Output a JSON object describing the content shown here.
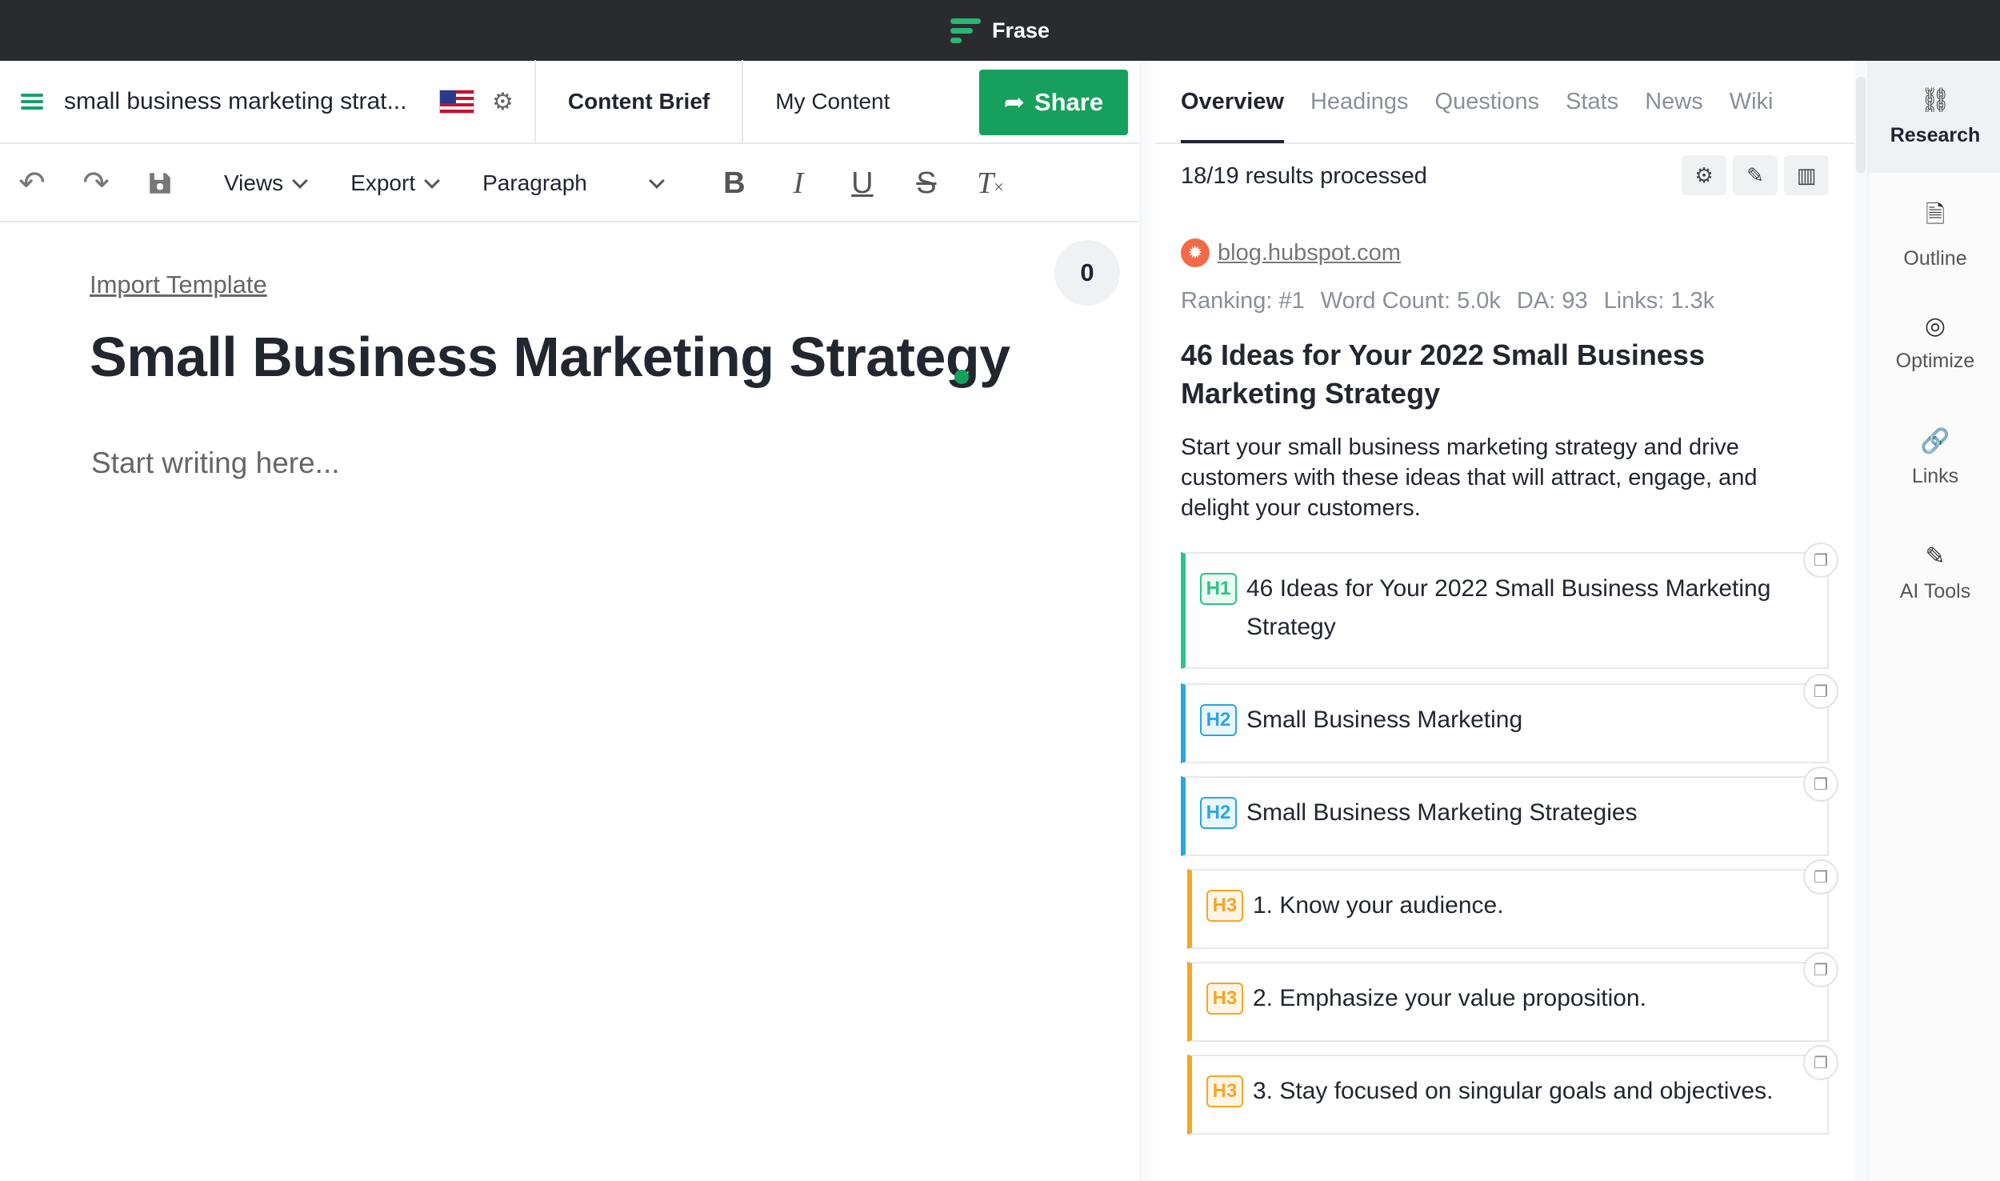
{
  "window": {
    "app_name": "Frase"
  },
  "topbar": {
    "doc_title": "small business marketing strat...",
    "tabs": [
      {
        "label": "Content Brief"
      },
      {
        "label": "My Content"
      }
    ],
    "share_label": "Share"
  },
  "toolbar": {
    "views_label": "Views",
    "export_label": "Export",
    "paragraph_label": "Paragraph"
  },
  "editor": {
    "import_template": "Import Template",
    "title": "Small Business Marketing Strategy",
    "placeholder": "Start writing here...",
    "counter": "0"
  },
  "research": {
    "tabs": [
      "Overview",
      "Headings",
      "Questions",
      "Stats",
      "News",
      "Wiki"
    ],
    "results_processed": "18/19 results processed",
    "source": "blog.hubspot.com",
    "meta": [
      "Ranking: #1",
      "Word Count: 5.0k",
      "DA: 93",
      "Links: 1.3k"
    ],
    "result_title": "46 Ideas for Your 2022 Small Business Marketing Strategy",
    "result_desc": "Start your small business marketing strategy and drive customers with these ideas that will attract, engage, and delight your customers.",
    "headings": [
      {
        "level": "H1",
        "text": "46 Ideas for Your 2022 Small Business Marketing Strategy"
      },
      {
        "level": "H2",
        "text": "Small Business Marketing"
      },
      {
        "level": "H2",
        "text": "Small Business Marketing Strategies"
      },
      {
        "level": "H3",
        "text": "1. Know your audience."
      },
      {
        "level": "H3",
        "text": "2. Emphasize your value proposition."
      },
      {
        "level": "H3",
        "text": "3. Stay focused on singular goals and objectives."
      }
    ]
  },
  "rail": {
    "items": [
      {
        "label": "Research",
        "icon": "binoculars-icon"
      },
      {
        "label": "Outline",
        "icon": "document-icon"
      },
      {
        "label": "Optimize",
        "icon": "target-icon"
      },
      {
        "label": "Links",
        "icon": "link-icon"
      },
      {
        "label": "AI Tools",
        "icon": "magic-wand-icon"
      }
    ]
  },
  "colors": {
    "accent": "#17a05d",
    "h1": "#2bc487",
    "h2": "#2aa6e2",
    "h3": "#f5a623"
  }
}
